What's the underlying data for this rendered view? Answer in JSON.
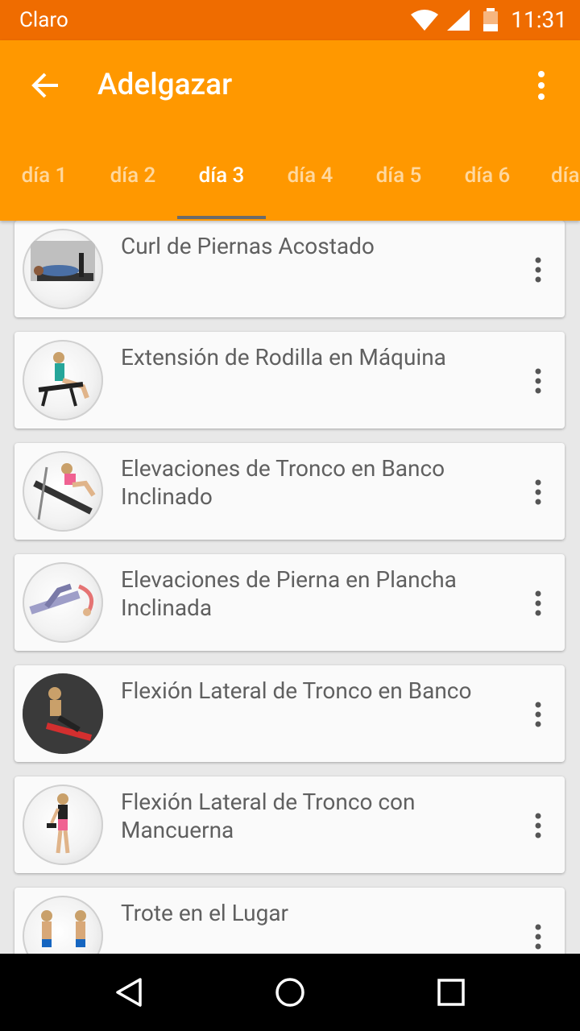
{
  "status_bar": {
    "carrier": "Claro",
    "time": "11:31"
  },
  "app_bar": {
    "title": "Adelgazar"
  },
  "tabs": [
    {
      "label": "día 1"
    },
    {
      "label": "día 2"
    },
    {
      "label": "día 3"
    },
    {
      "label": "día 4"
    },
    {
      "label": "día 5"
    },
    {
      "label": "día 6"
    },
    {
      "label": "día"
    }
  ],
  "selected_tab": "día 3",
  "exercises": [
    {
      "name": "Curl de Piernas Acostado"
    },
    {
      "name": "Extensión de Rodilla en Máquina"
    },
    {
      "name": "Elevaciones de Tronco en Banco Inclinado"
    },
    {
      "name": "Elevaciones de Pierna en Plancha Inclinada"
    },
    {
      "name": "Flexión Lateral de Tronco en Banco"
    },
    {
      "name": "Flexión Lateral de Tronco con Mancuerna"
    },
    {
      "name": "Trote en el Lugar"
    }
  ],
  "colors": {
    "status_bar": "#ef6c00",
    "app_bar": "#ff9800",
    "card": "#fafafa",
    "text": "#606060"
  },
  "icons": {
    "back": "arrow-back-icon",
    "overflow": "more-vert-icon",
    "nav_back": "triangle-back-icon",
    "nav_home": "circle-home-icon",
    "nav_recents": "square-recents-icon"
  }
}
